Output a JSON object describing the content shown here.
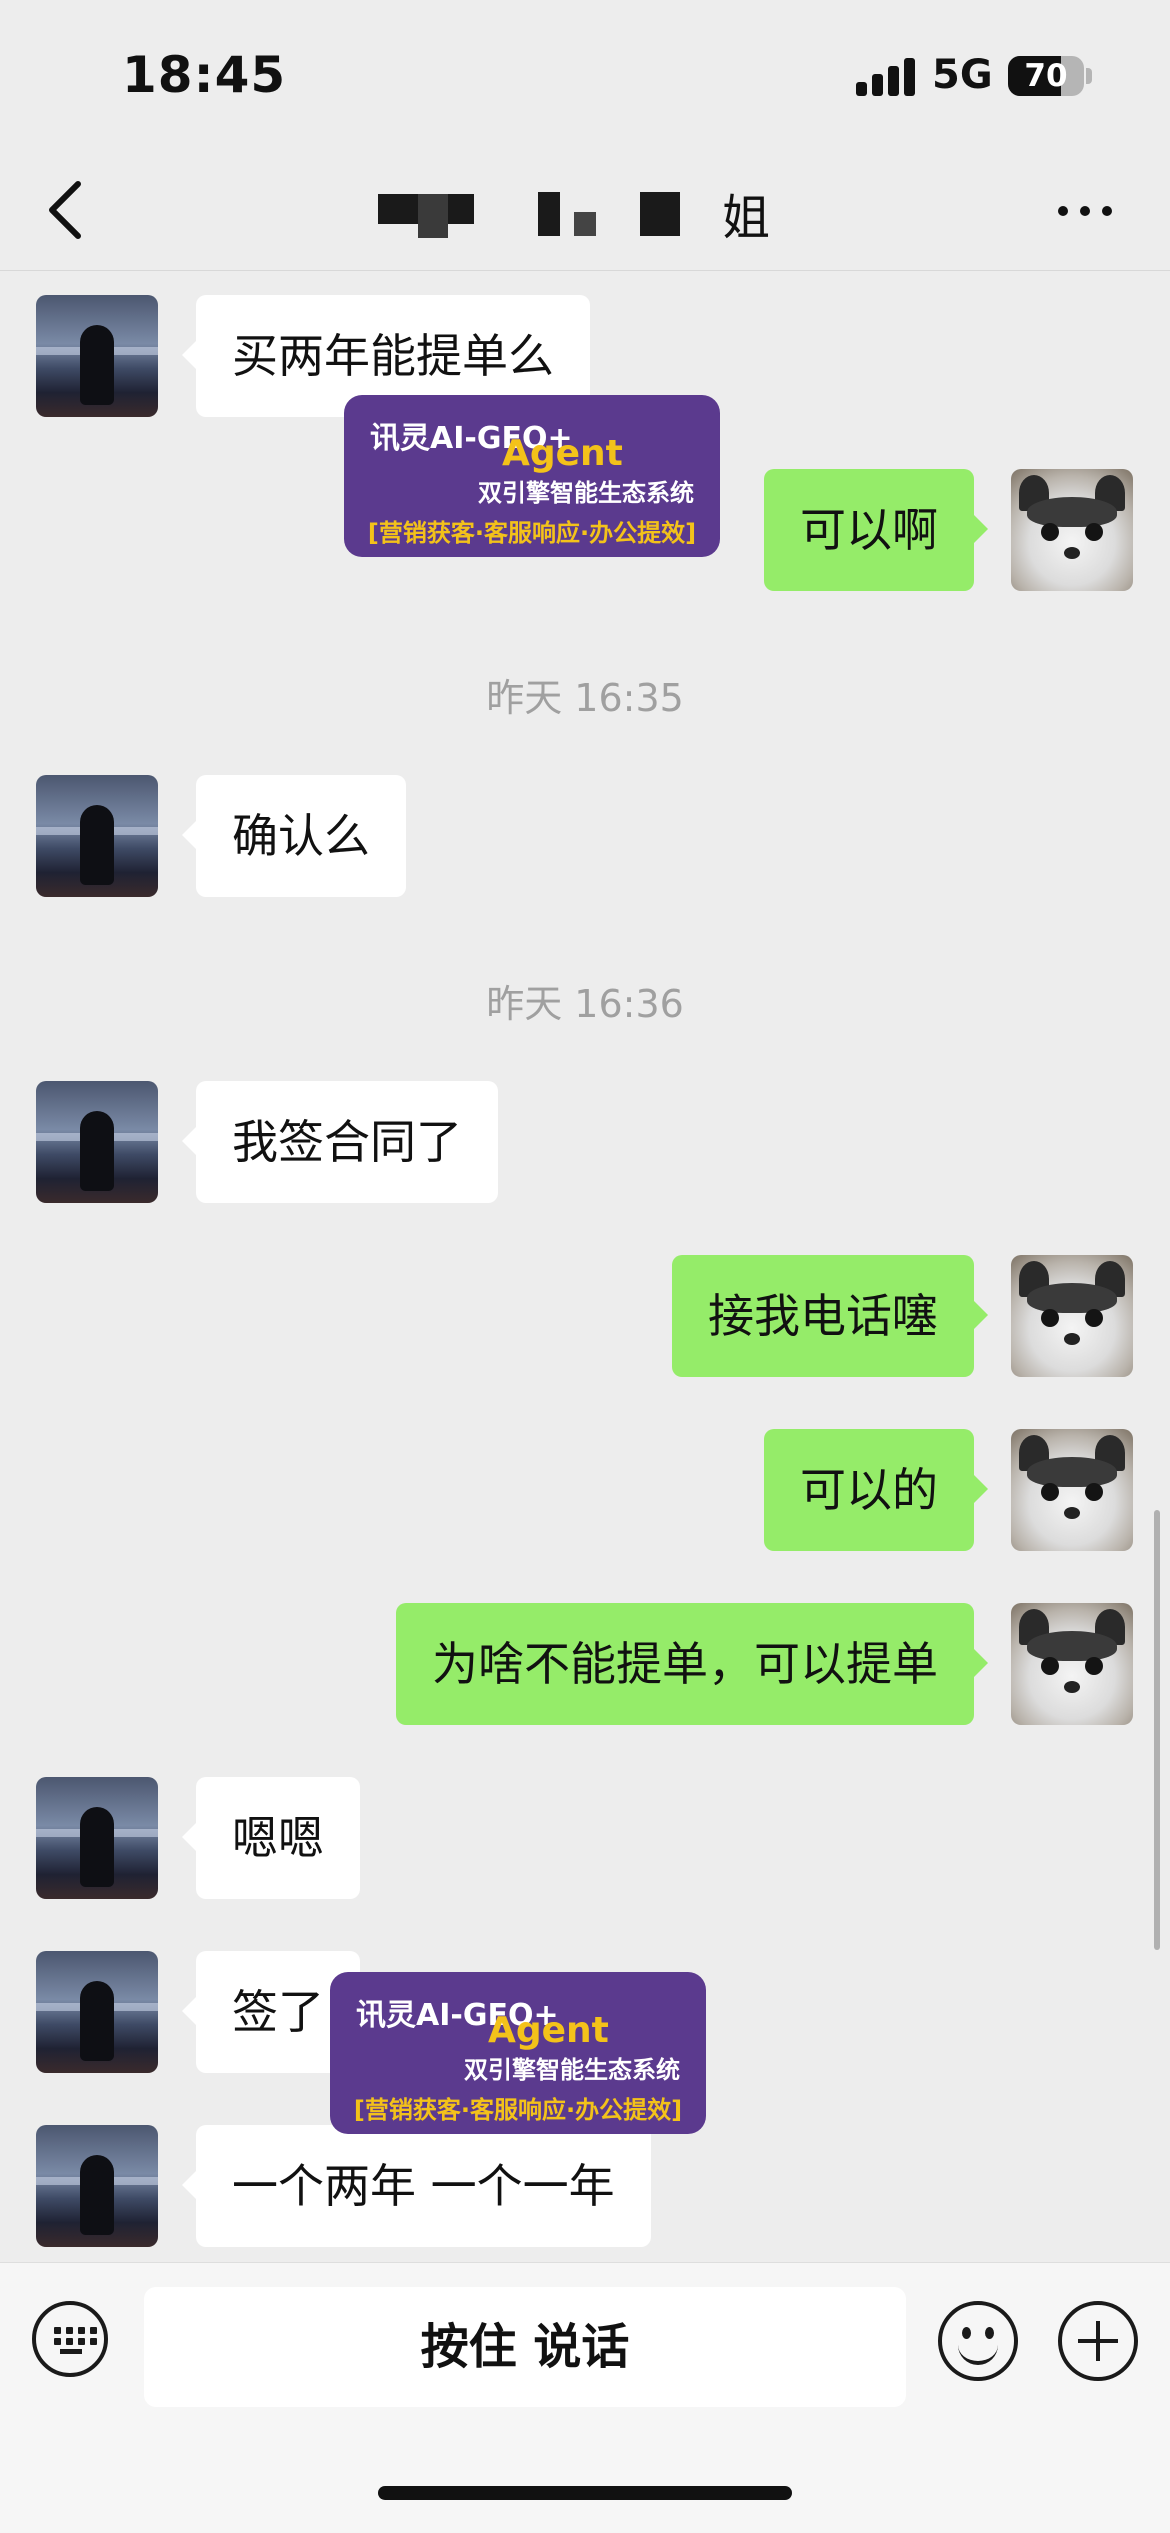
{
  "status_bar": {
    "time": "18:45",
    "network": "5G",
    "battery": "70",
    "battery_level": 0.7
  },
  "nav": {
    "title": "姐"
  },
  "messages": [
    {
      "from": "them",
      "text": "买两年能提单么"
    },
    {
      "from": "me",
      "text": "可以啊"
    },
    {
      "type": "time",
      "text": "昨天 16:35"
    },
    {
      "from": "them",
      "text": "确认么"
    },
    {
      "type": "time",
      "text": "昨天 16:36"
    },
    {
      "from": "them",
      "text": "我签合同了"
    },
    {
      "from": "me",
      "text": "接我电话噻"
    },
    {
      "from": "me",
      "text": "可以的"
    },
    {
      "from": "me",
      "text": "为啥不能提单，可以提单"
    },
    {
      "from": "them",
      "text": "嗯嗯"
    },
    {
      "from": "them",
      "text": "签了"
    },
    {
      "from": "them",
      "text": "一个两年 一个一年"
    }
  ],
  "ad": {
    "line1": "讯灵AI-GEO+",
    "line1b": "Agent",
    "line2": "双引擎智能生态系统",
    "line3": "[营销获客·客服响应·办公提效]"
  },
  "input": {
    "talk_label": "按住 说话"
  },
  "icons": {
    "back": "chevron-left-icon",
    "more": "more-dots-icon",
    "keyboard": "keyboard-icon",
    "emoji": "emoji-icon",
    "plus": "plus-icon"
  },
  "colors": {
    "my_bubble": "#95ec69",
    "their_bubble": "#ffffff",
    "background": "#ededed",
    "ad_bg": "#5b3a8e",
    "ad_accent": "#f3c21a"
  }
}
